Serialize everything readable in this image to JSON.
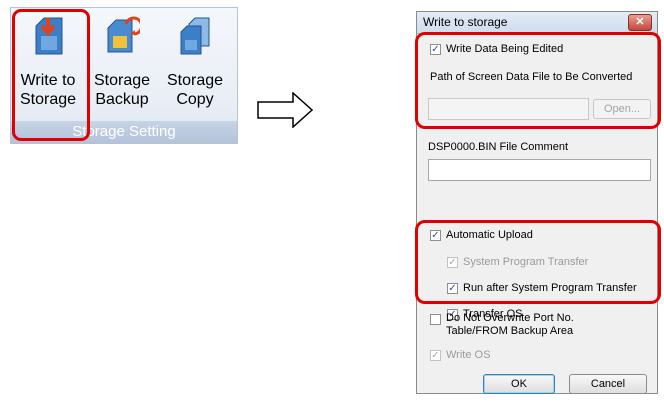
{
  "ribbon": {
    "buttons": [
      {
        "label": "Write to\nStorage",
        "icon": "write-to-storage-icon"
      },
      {
        "label": "Storage\nBackup",
        "icon": "storage-backup-icon"
      },
      {
        "label": "Storage\nCopy",
        "icon": "storage-copy-icon"
      }
    ],
    "group_label": "Storage Setting"
  },
  "arrow": {
    "icon": "right-arrow-icon"
  },
  "dialog": {
    "title": "Write to storage",
    "close_glyph": "✕",
    "write_data": {
      "label": "Write Data Being Edited",
      "checked": true
    },
    "path_label": "Path of Screen Data File to Be Converted",
    "path_value": "",
    "open_label": "Open...",
    "comment_label": "DSP0000.BIN File Comment",
    "comment_value": "",
    "auto_upload": {
      "label": "Automatic Upload",
      "checked": true
    },
    "system_program": {
      "label": "System Program Transfer",
      "checked": true,
      "disabled": true
    },
    "run_after": {
      "label": "Run after System Program Transfer",
      "checked": true
    },
    "transfer_os": {
      "label": "Transfer OS",
      "checked": true
    },
    "no_overwrite": {
      "label_line1": "Do Not Overwrite Port No.",
      "label_line2": "Table/FROM Backup Area",
      "checked": false
    },
    "write_os": {
      "label": "Write OS",
      "checked": true,
      "disabled": true
    },
    "ok_label": "OK",
    "cancel_label": "Cancel"
  },
  "colors": {
    "highlight": "#e00000",
    "ribbon_group": "#b4c3da"
  }
}
